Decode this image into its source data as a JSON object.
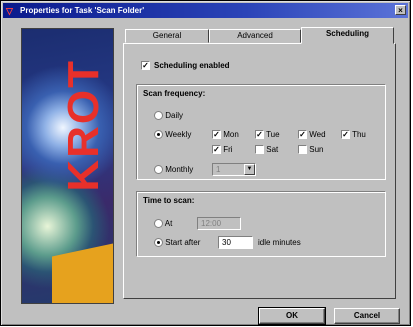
{
  "window": {
    "title": "Properties for Task 'Scan Folder'",
    "close_glyph": "×"
  },
  "sidebar_image": {
    "logo_text": "KROT"
  },
  "tabs": [
    {
      "label": "General",
      "active": false
    },
    {
      "label": "Advanced",
      "active": false
    },
    {
      "label": "Scheduling",
      "active": true
    }
  ],
  "scheduling": {
    "enabled_label": "Scheduling enabled",
    "enabled": true
  },
  "frequency": {
    "group_label": "Scan frequency:",
    "daily_label": "Daily",
    "weekly_label": "Weekly",
    "monthly_label": "Monthly",
    "selected": "Weekly",
    "days": [
      {
        "label": "Mon",
        "checked": true
      },
      {
        "label": "Tue",
        "checked": true
      },
      {
        "label": "Wed",
        "checked": true
      },
      {
        "label": "Thu",
        "checked": true
      },
      {
        "label": "Fri",
        "checked": true
      },
      {
        "label": "Sat",
        "checked": false
      },
      {
        "label": "Sun",
        "checked": false
      }
    ],
    "monthly_value": "1"
  },
  "time": {
    "group_label": "Time to scan:",
    "at_label": "At",
    "at_value": "12:00",
    "start_after_label": "Start after",
    "start_after_value": "30",
    "idle_label": "idle minutes",
    "selected": "Start after"
  },
  "buttons": {
    "ok": "OK",
    "cancel": "Cancel"
  },
  "colors": {
    "title_start": "#0a1a8c",
    "face": "#c0c0c0",
    "logo": "#e8302a"
  }
}
